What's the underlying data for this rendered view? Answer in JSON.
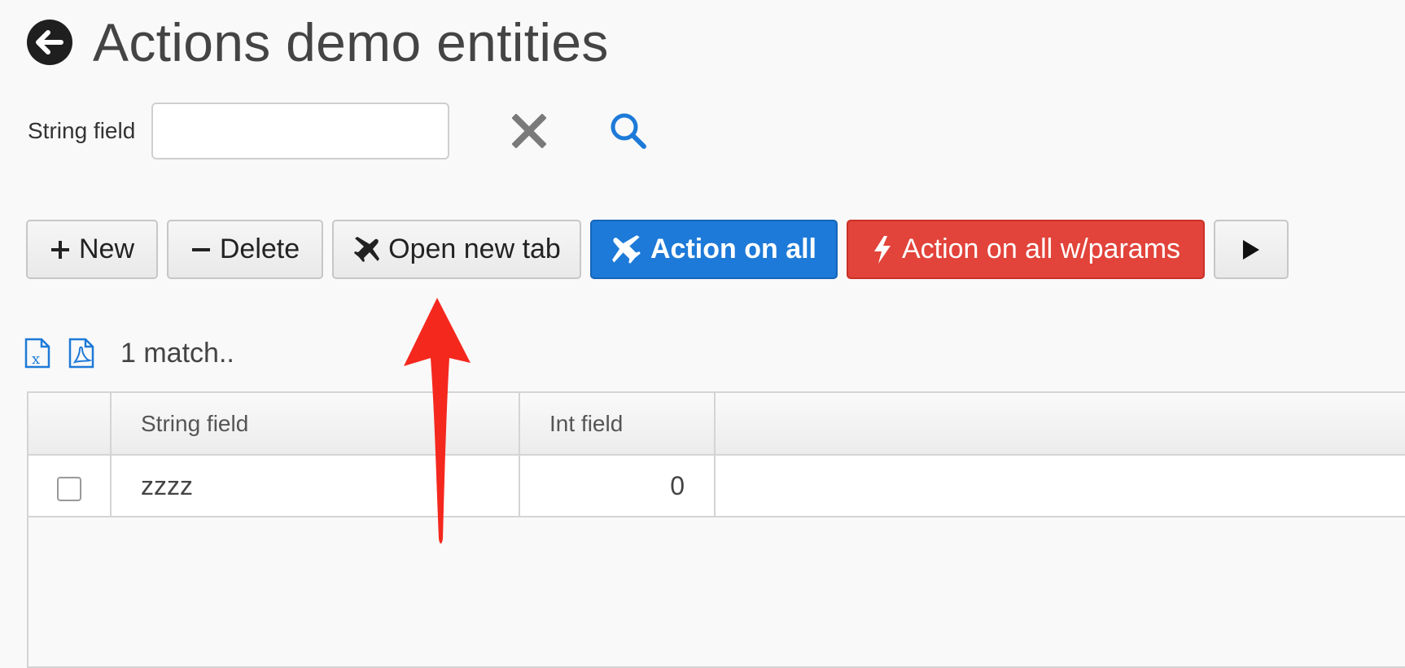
{
  "header": {
    "title": "Actions demo entities",
    "back_icon": "arrow-left-circle-icon"
  },
  "filter": {
    "label": "String field",
    "value": "",
    "placeholder": ""
  },
  "toolbar": {
    "new_label": "New",
    "delete_label": "Delete",
    "open_new_tab_label": "Open new tab",
    "action_on_all_label": "Action on all",
    "action_on_all_params_label": "Action on all w/params"
  },
  "results": {
    "count_text": "1 match.."
  },
  "grid": {
    "columns": [
      "",
      "String field",
      "Int field",
      ""
    ],
    "rows": [
      {
        "checked": false,
        "string_field": "zzzz",
        "int_field": "0"
      }
    ]
  },
  "colors": {
    "primary": "#1d7ad8",
    "danger": "#e2433a",
    "annotation_arrow": "#f5281e",
    "icon_blue": "#1d7ad8"
  }
}
